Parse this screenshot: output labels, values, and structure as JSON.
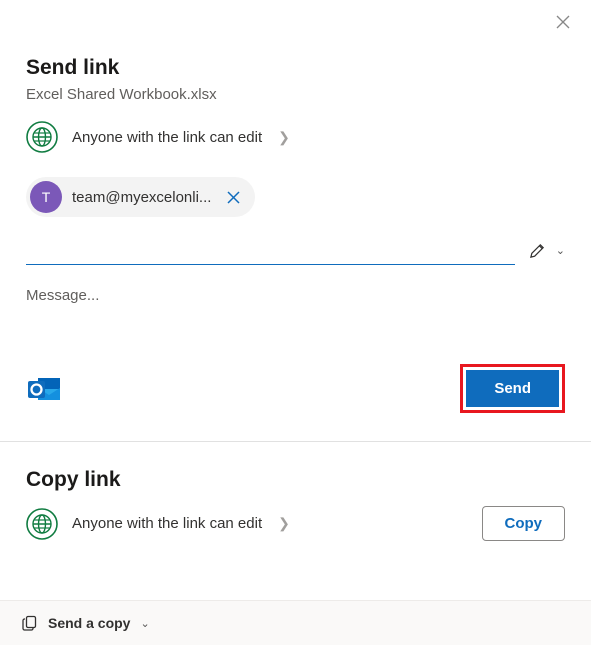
{
  "dialog": {
    "title": "Send link",
    "filename": "Excel Shared Workbook.xlsx"
  },
  "permissions": {
    "label": "Anyone with the link can edit"
  },
  "recipient": {
    "initial": "T",
    "email": "team@myexcelonli..."
  },
  "message": {
    "placeholder": "Message..."
  },
  "buttons": {
    "send": "Send",
    "copy": "Copy"
  },
  "copySection": {
    "title": "Copy link",
    "permission": "Anyone with the link can edit"
  },
  "footer": {
    "label": "Send a copy"
  }
}
